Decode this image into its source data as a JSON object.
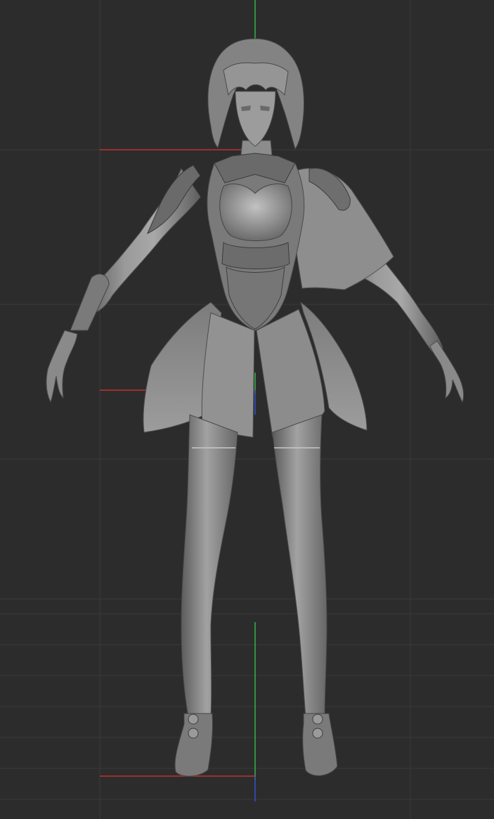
{
  "viewport": {
    "background": "#2c2c2c",
    "grid_color": "#3a3a3a",
    "x_axis_color": "#c0312e",
    "y_axis_color": "#37b14a",
    "z_axis_color": "#3550c8"
  },
  "model": {
    "base_color": "#8a8a8a",
    "shadow_color": "#4c4c4c",
    "highlight_color": "#b5b5b5"
  }
}
